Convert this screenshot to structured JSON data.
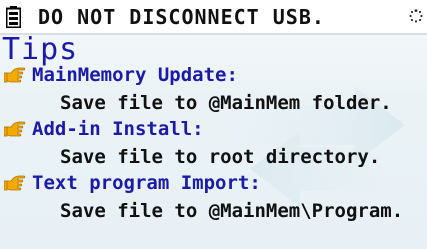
{
  "status_bar": {
    "message": "DO NOT DISCONNECT USB.",
    "left_icon": "battery-icon",
    "right_icon": "busy-spinner-icon"
  },
  "title": "Tips",
  "tips": [
    {
      "heading": "MainMemory Update:",
      "detail": "Save file to @MainMem folder.",
      "icon": "pointing-hand-icon"
    },
    {
      "heading": "Add-in Install:",
      "detail": "Save file to root directory.",
      "icon": "pointing-hand-icon"
    },
    {
      "heading": "Text program Import:",
      "detail": "Save file to @MainMem\\Program.",
      "icon": "pointing-hand-icon"
    }
  ],
  "colors": {
    "heading": "#1b1ba8",
    "detail": "#111111",
    "icon": "#f2a900"
  }
}
